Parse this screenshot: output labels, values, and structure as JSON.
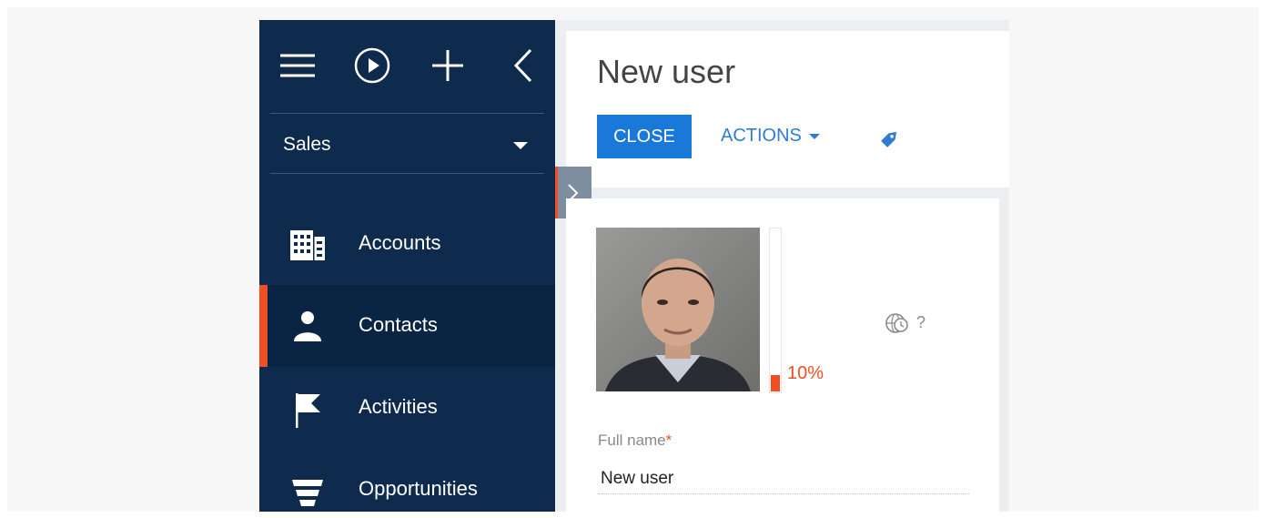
{
  "sidebar": {
    "workspace": "Sales",
    "items": [
      {
        "label": "Accounts",
        "icon": "building-icon",
        "active": false
      },
      {
        "label": "Contacts",
        "icon": "person-icon",
        "active": true
      },
      {
        "label": "Activities",
        "icon": "flag-icon",
        "active": false
      },
      {
        "label": "Opportunities",
        "icon": "funnel-icon",
        "active": false
      }
    ]
  },
  "topbar": {
    "icons": [
      "hamburger-menu-icon",
      "play-circle-icon",
      "plus-icon",
      "chevron-left-icon"
    ]
  },
  "header": {
    "title": "New user",
    "close_label": "CLOSE",
    "actions_label": "ACTIONS"
  },
  "profile": {
    "completeness_label": "10%",
    "completeness": 0.1,
    "timezone_label": "?"
  },
  "form": {
    "full_name_label": "Full name",
    "required_mark": "*",
    "full_name_value": "New user"
  },
  "colors": {
    "sidebar": "#0e2b4e",
    "accent": "#ef4f23",
    "primary_button": "#1a78d8",
    "link": "#2f7bd6"
  }
}
